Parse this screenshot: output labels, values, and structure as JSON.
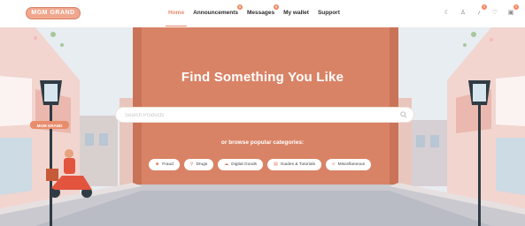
{
  "brand": {
    "logo_text": "MGM GRAND"
  },
  "nav": {
    "links": [
      {
        "label": "Home",
        "active": true,
        "badge": ""
      },
      {
        "label": "Announcements",
        "active": false,
        "badge": "0"
      },
      {
        "label": "Messages",
        "active": false,
        "badge": "0"
      },
      {
        "label": "My wallet",
        "active": false,
        "badge": ""
      },
      {
        "label": "Support",
        "active": false,
        "badge": ""
      }
    ],
    "icons": [
      {
        "name": "moon-icon",
        "glyph": "☾",
        "badge": ""
      },
      {
        "name": "user-icon",
        "glyph": "♙",
        "badge": ""
      },
      {
        "name": "bell-icon",
        "glyph": "♪",
        "badge": "0"
      },
      {
        "name": "heart-icon",
        "glyph": "♡",
        "badge": ""
      },
      {
        "name": "cart-icon",
        "glyph": "▣",
        "badge": "0"
      }
    ]
  },
  "hero": {
    "title": "Find Something You Like",
    "search_placeholder": "Search Products",
    "browse_text": "or browse popular categories:",
    "signpost_text": "MGM GRAND",
    "categories": [
      {
        "label": "Fraud",
        "icon": "mask-icon",
        "glyph": "☻"
      },
      {
        "label": "Drugs",
        "icon": "pill-icon",
        "glyph": "⚲"
      },
      {
        "label": "Digital Goods",
        "icon": "cloud-icon",
        "glyph": "☁"
      },
      {
        "label": "Guides & Tutorials",
        "icon": "book-icon",
        "glyph": "▤"
      },
      {
        "label": "Miscellaneous",
        "icon": "glasses-icon",
        "glyph": "∞"
      }
    ]
  },
  "colors": {
    "accent": "#e58a6b",
    "building": "#d98366",
    "sky": "#e7ecf1"
  }
}
